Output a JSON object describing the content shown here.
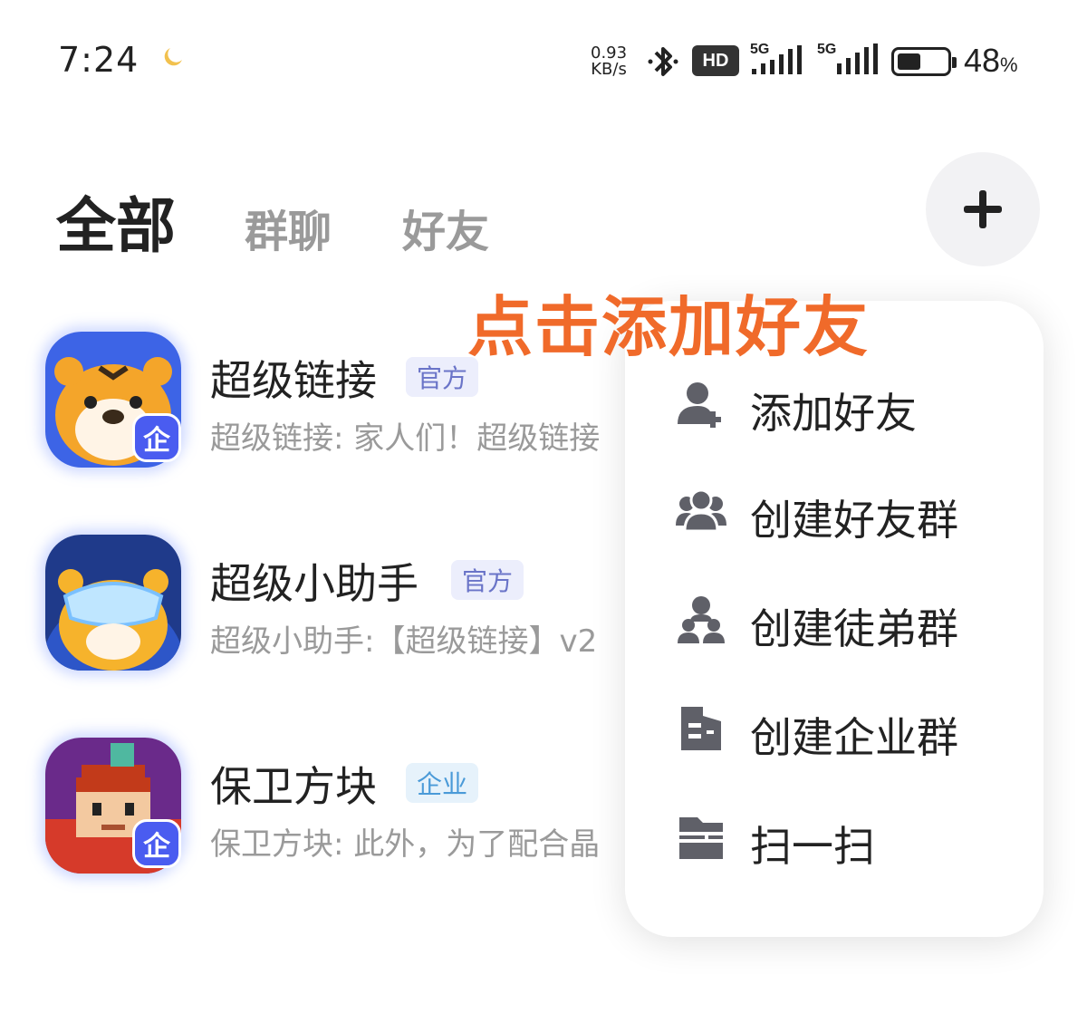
{
  "status_bar": {
    "time": "7:24",
    "net_speed_value": "0.93",
    "net_speed_unit": "KB/s",
    "hd_label": "HD",
    "signal1_label": "5G",
    "signal2_label": "5G",
    "battery_percent": "48",
    "battery_unit": "%",
    "battery_level": 0.48
  },
  "tabs": {
    "all": "全部",
    "group": "群聊",
    "friend": "好友"
  },
  "annotation": "点击添加好友",
  "chats": [
    {
      "name": "超级链接",
      "tag": "官方",
      "message": "超级链接: 家人们！超级链接",
      "badge": "企"
    },
    {
      "name": "超级小助手",
      "tag": "官方",
      "message": "超级小助手:【超级链接】v2",
      "badge": ""
    },
    {
      "name": "保卫方块",
      "tag": "企业",
      "message": "保卫方块: 此外，为了配合晶",
      "badge": "企"
    }
  ],
  "menu": {
    "items": [
      {
        "label": "添加好友",
        "icon": "add-friend-icon"
      },
      {
        "label": "创建好友群",
        "icon": "friend-group-icon"
      },
      {
        "label": "创建徒弟群",
        "icon": "apprentice-group-icon"
      },
      {
        "label": "创建企业群",
        "icon": "enterprise-group-icon"
      },
      {
        "label": "扫一扫",
        "icon": "scan-icon"
      }
    ]
  },
  "colors": {
    "annotation": "#f06a2a",
    "enterprise_badge": "#4a5cf0",
    "icon_gray": "#5f6068"
  }
}
